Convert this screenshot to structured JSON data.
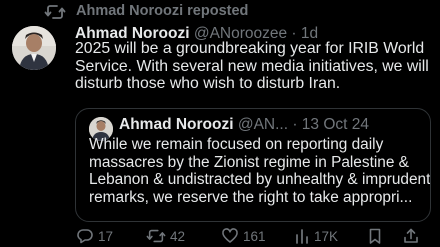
{
  "repost": {
    "icon": "repost-icon",
    "label": "Ahmad Noroozi reposted"
  },
  "tweet": {
    "author_name": "Ahmad Noroozi",
    "author_meta": " @ANoroozee · 1d",
    "text": "2025 will be a groundbreaking year for IRIB World Service. With several new media initiatives, we will disturb those who wish to disturb Iran."
  },
  "quote": {
    "author_name": "Ahmad Noroozi",
    "author_meta": " @AN... · 13 Oct 24",
    "text": "While we remain focused on reporting daily massacres by the Zionist regime in Palestine & Lebanon & undistracted by unhealthy & imprudent remarks, we reserve the right to take appropri..."
  },
  "actions": {
    "replies": "17",
    "reposts": "42",
    "likes": "161",
    "views": "17K"
  }
}
